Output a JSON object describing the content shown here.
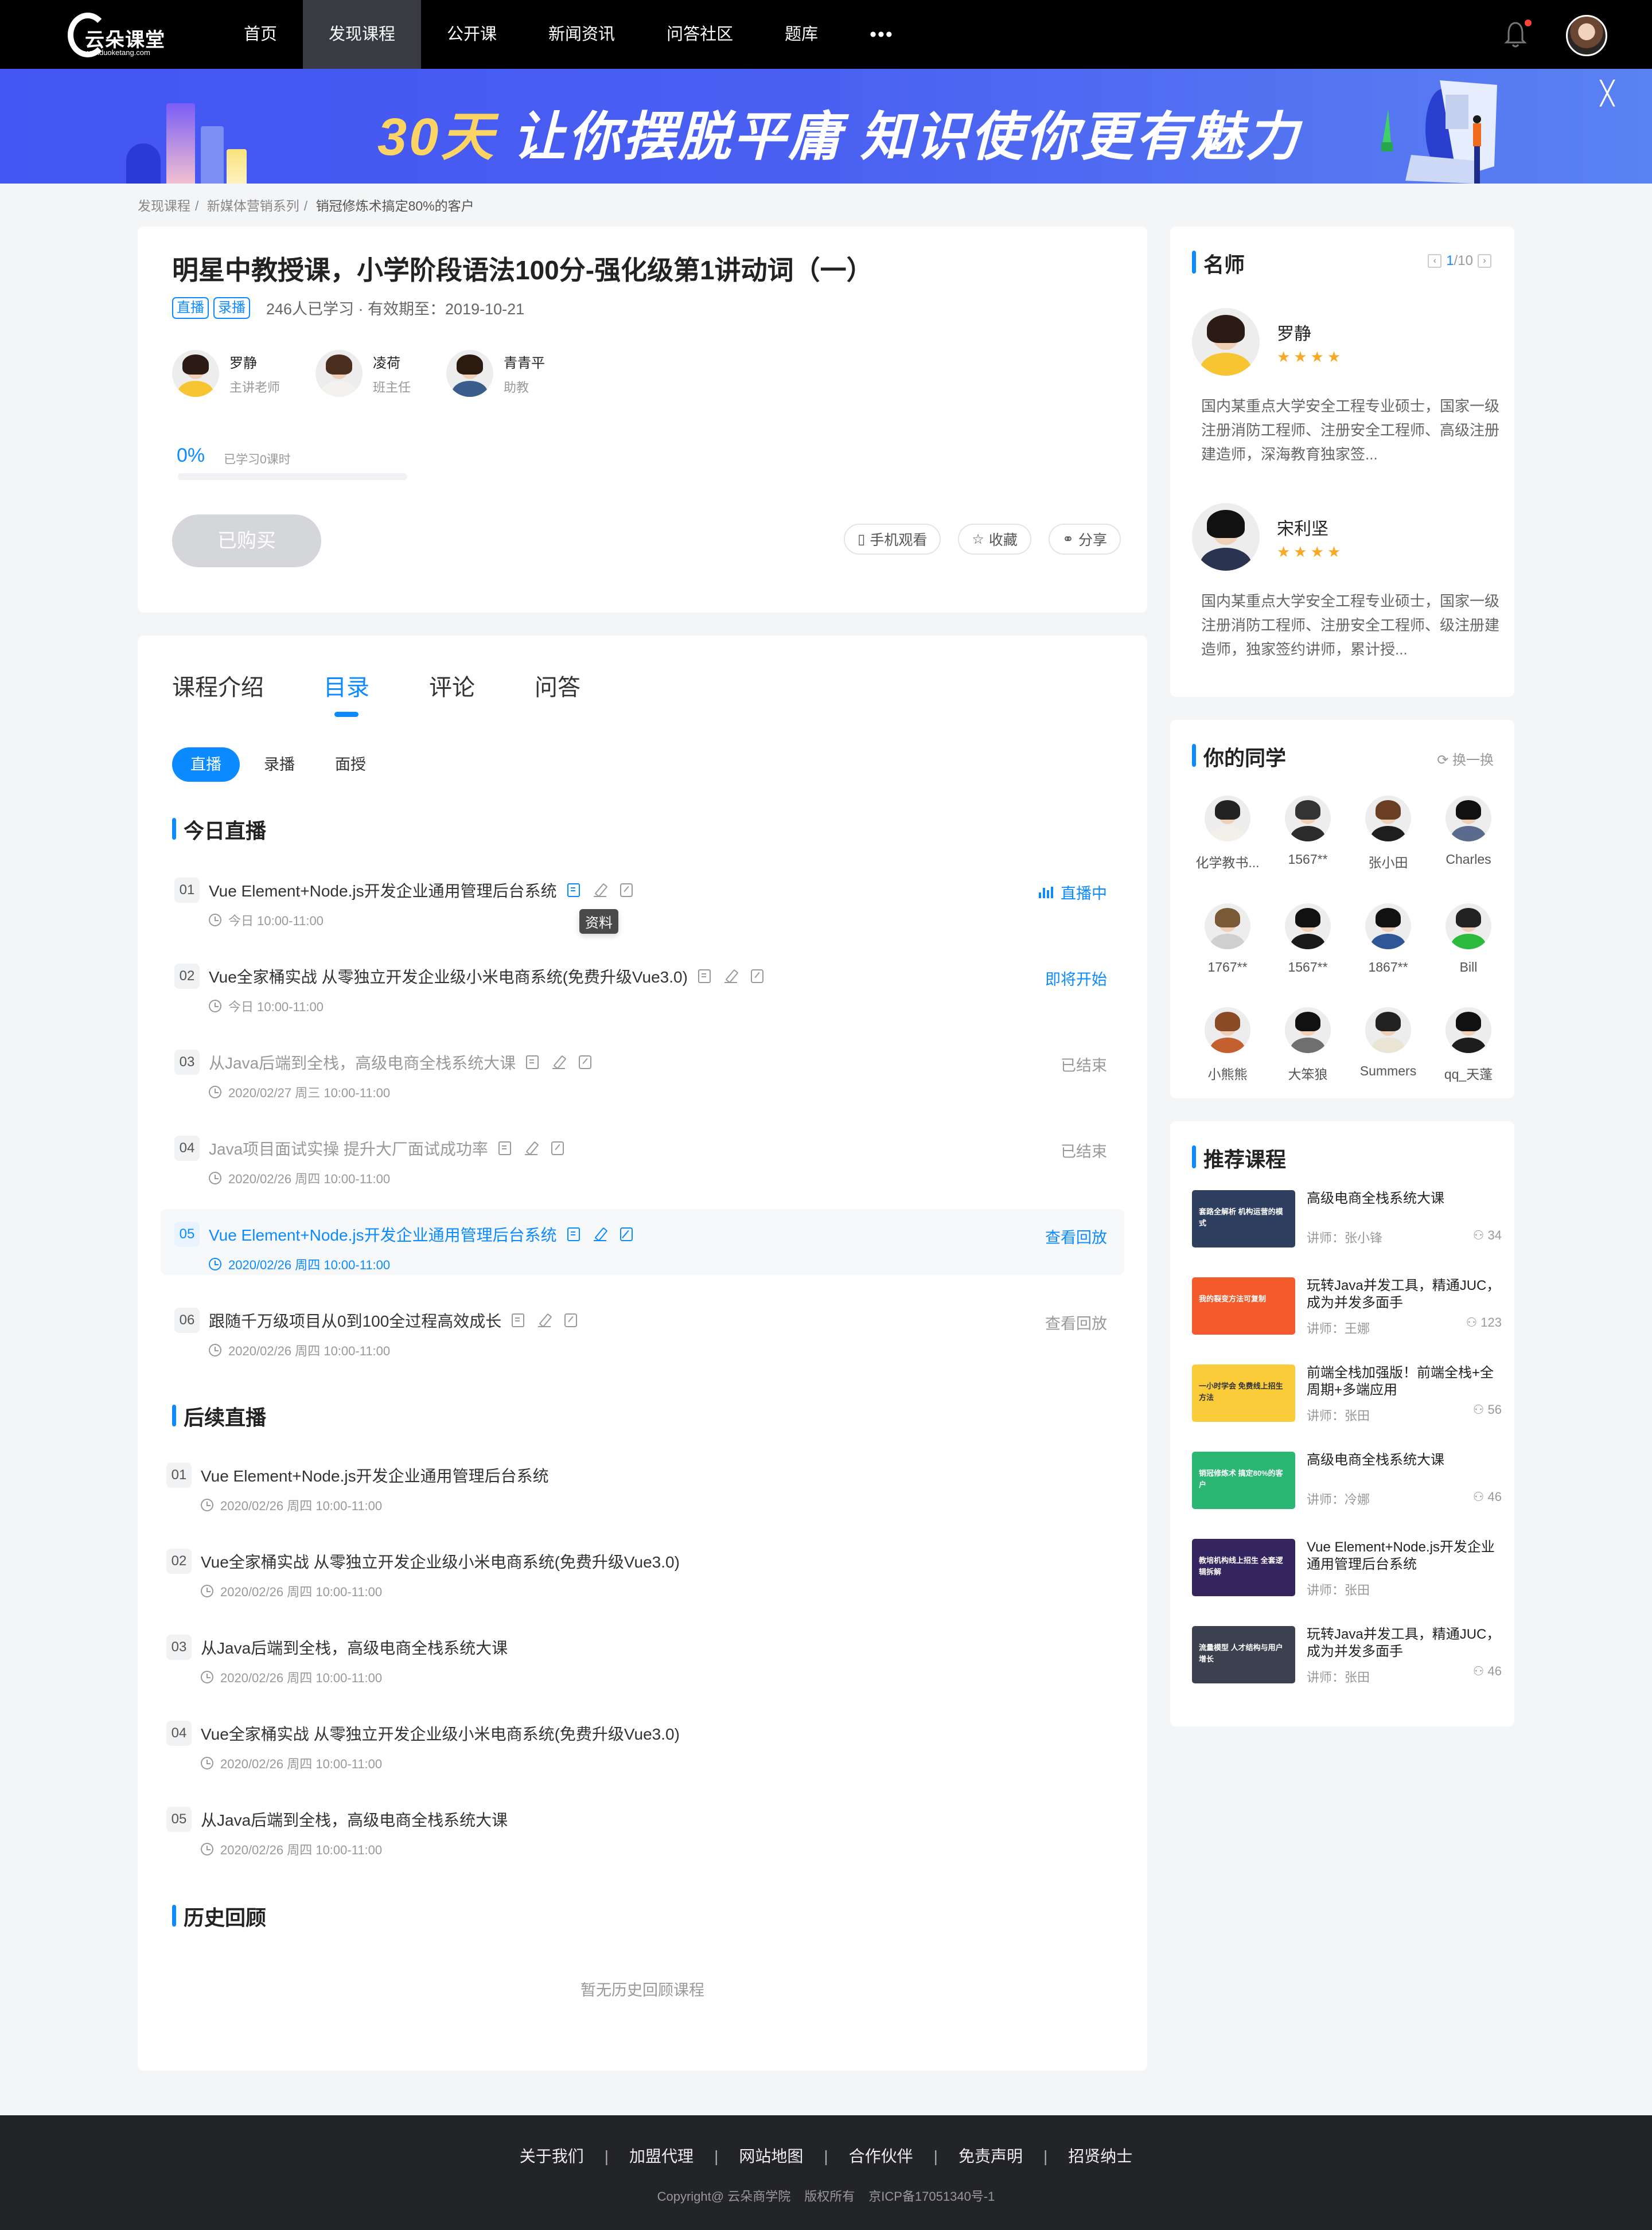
{
  "nav": {
    "logo_text": "云朵课堂",
    "logo_sub": "yunduoketang.com",
    "items": [
      "首页",
      "发现课程",
      "公开课",
      "新闻资讯",
      "问答社区",
      "题库"
    ],
    "active": "发现课程",
    "more": "•••"
  },
  "banner": {
    "highlight": "30天",
    "text": "让你摆脱平庸 知识使你更有魅力",
    "close": "╳"
  },
  "breadcrumb": [
    "发现课程",
    "新媒体营销系列",
    "销冠修炼术搞定80%的客户"
  ],
  "course": {
    "title": "明星中教授课，小学阶段语法100分-强化级第1讲动词（一）",
    "tags": [
      "直播",
      "录播"
    ],
    "meta": "246人已学习 · 有效期至：2019-10-21",
    "teachers": [
      {
        "name": "罗静",
        "role": "主讲老师"
      },
      {
        "name": "凌荷",
        "role": "班主任"
      },
      {
        "name": "青青平",
        "role": "助教"
      }
    ],
    "progress_percent": 0,
    "progress_label": "0%",
    "progress_text": "已学习0课时",
    "bought_label": "已购买",
    "actions": [
      {
        "icon": "mobile-icon",
        "label": "手机观看"
      },
      {
        "icon": "star-icon",
        "label": "收藏"
      },
      {
        "icon": "share-icon",
        "label": "分享"
      }
    ]
  },
  "tabs": [
    "课程介绍",
    "目录",
    "评论",
    "问答"
  ],
  "active_tab": "目录",
  "subtabs": [
    "直播",
    "录播",
    "面授"
  ],
  "active_subtab": "直播",
  "today": {
    "heading": "今日直播",
    "lessons": [
      {
        "num": "01",
        "title": "Vue Element+Node.js开发企业通用管理后台系统",
        "time": "今日 10:00-11:00",
        "status": "直播中",
        "state": "live"
      },
      {
        "num": "02",
        "title": "Vue全家桶实战 从零独立开发企业级小米电商系统(免费升级Vue3.0)",
        "time": "今日 10:00-11:00",
        "status": "即将开始",
        "state": "upcoming"
      },
      {
        "num": "03",
        "title": "从Java后端到全栈，高级电商全栈系统大课",
        "time": "2020/02/27 周三 10:00-11:00",
        "status": "已结束",
        "state": "done"
      },
      {
        "num": "04",
        "title": "Java项目面试实操 提升大厂面试成功率",
        "time": "2020/02/26 周四 10:00-11:00",
        "status": "已结束",
        "state": "done"
      },
      {
        "num": "05",
        "title": "Vue Element+Node.js开发企业通用管理后台系统",
        "time": "2020/02/26 周四 10:00-11:00",
        "status": "查看回放",
        "state": "highlight"
      },
      {
        "num": "06",
        "title": "跟随千万级项目从0到100全过程高效成长",
        "time": "2020/02/26 周四 10:00-11:00",
        "status": "查看回放",
        "state": "replay"
      }
    ],
    "tooltip": "资料"
  },
  "upcoming": {
    "heading": "后续直播",
    "lessons": [
      {
        "num": "01",
        "title": "Vue Element+Node.js开发企业通用管理后台系统",
        "time": "2020/02/26 周四 10:00-11:00"
      },
      {
        "num": "02",
        "title": "Vue全家桶实战 从零独立开发企业级小米电商系统(免费升级Vue3.0)",
        "time": "2020/02/26 周四 10:00-11:00"
      },
      {
        "num": "03",
        "title": "从Java后端到全栈，高级电商全栈系统大课",
        "time": "2020/02/26 周四 10:00-11:00"
      },
      {
        "num": "04",
        "title": "Vue全家桶实战 从零独立开发企业级小米电商系统(免费升级Vue3.0)",
        "time": "2020/02/26 周四 10:00-11:00"
      },
      {
        "num": "05",
        "title": "从Java后端到全栈，高级电商全栈系统大课",
        "time": "2020/02/26 周四 10:00-11:00"
      }
    ]
  },
  "history": {
    "heading": "历史回顾",
    "empty": "暂无历史回顾课程"
  },
  "famous": {
    "heading": "名师",
    "page": "1",
    "total": "/10",
    "teachers": [
      {
        "name": "罗静",
        "stars": 4,
        "desc": "国内某重点大学安全工程专业硕士，国家一级注册消防工程师、注册安全工程师、高级注册建造师，深海教育独家签..."
      },
      {
        "name": "宋利坚",
        "stars": 4,
        "desc": "国内某重点大学安全工程专业硕士，国家一级注册消防工程师、注册安全工程师、级注册建造师，独家签约讲师，累计授..."
      }
    ]
  },
  "classmates": {
    "heading": "你的同学",
    "refresh": "换一换",
    "people": [
      "化学教书...",
      "1567**",
      "张小田",
      "Charles",
      "1767**",
      "1567**",
      "1867**",
      "Bill",
      "小熊熊",
      "大笨狼",
      "Summers",
      "qq_天蓬"
    ]
  },
  "recommend": {
    "heading": "推荐课程",
    "courses": [
      {
        "title": "高级电商全栈系统大课",
        "teacher": "讲师：张小锋",
        "count": "34",
        "thumb": "套路全解析 机构运营的模式",
        "color": "#2f3f5f"
      },
      {
        "title": "玩转Java并发工具，精通JUC，成为并发多面手",
        "teacher": "讲师：王娜",
        "count": "123",
        "thumb": "我的裂变方法可复制",
        "color": "#f45b2c"
      },
      {
        "title": "前端全栈加强版！前端全栈+全周期+多端应用",
        "teacher": "讲师：张田",
        "count": "56",
        "thumb": "一小时学会 免费线上招生方法",
        "color": "#fbcc3a"
      },
      {
        "title": "高级电商全栈系统大课",
        "teacher": "讲师：冷娜",
        "count": "46",
        "thumb": "销冠修炼术 搞定80%的客户",
        "color": "#2bb673"
      },
      {
        "title": "Vue Element+Node.js开发企业通用管理后台系统",
        "teacher": "讲师：张田",
        "count": "",
        "thumb": "教培机构线上招生 全套逻辑拆解",
        "color": "#34245f"
      },
      {
        "title": "玩转Java并发工具，精通JUC，成为并发多面手",
        "teacher": "讲师：张田",
        "count": "46",
        "thumb": "流量模型 人才结构与用户增长",
        "color": "#3c4150"
      }
    ]
  },
  "footer": {
    "links": [
      "关于我们",
      "加盟代理",
      "网站地图",
      "合作伙伴",
      "免责声明",
      "招贤纳士"
    ],
    "copyright": "Copyright@ 云朵商学院",
    "rights": "版权所有",
    "icp": "京ICP备17051340号-1"
  }
}
